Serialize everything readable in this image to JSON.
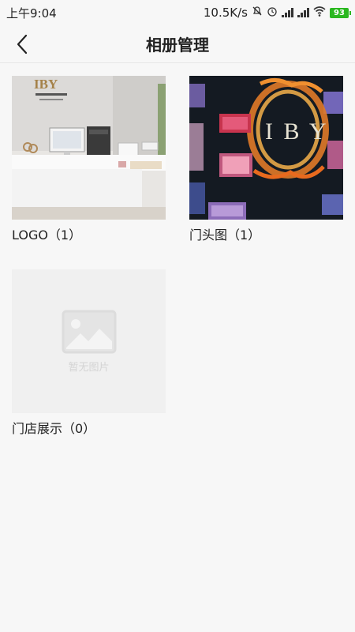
{
  "status": {
    "time": "上午9:04",
    "speed": "10.5K/s",
    "battery": "93"
  },
  "header": {
    "title": "相册管理"
  },
  "albums": [
    {
      "label": "LOGO（1）",
      "image": "office-reception-photo",
      "sign_text": "IBY"
    },
    {
      "label": "门头图（1）",
      "image": "storefront-sign-photo",
      "sign_text": "I B Y"
    },
    {
      "label": "门店展示（0）",
      "image": "placeholder",
      "placeholder_text": "暂无图片"
    }
  ]
}
